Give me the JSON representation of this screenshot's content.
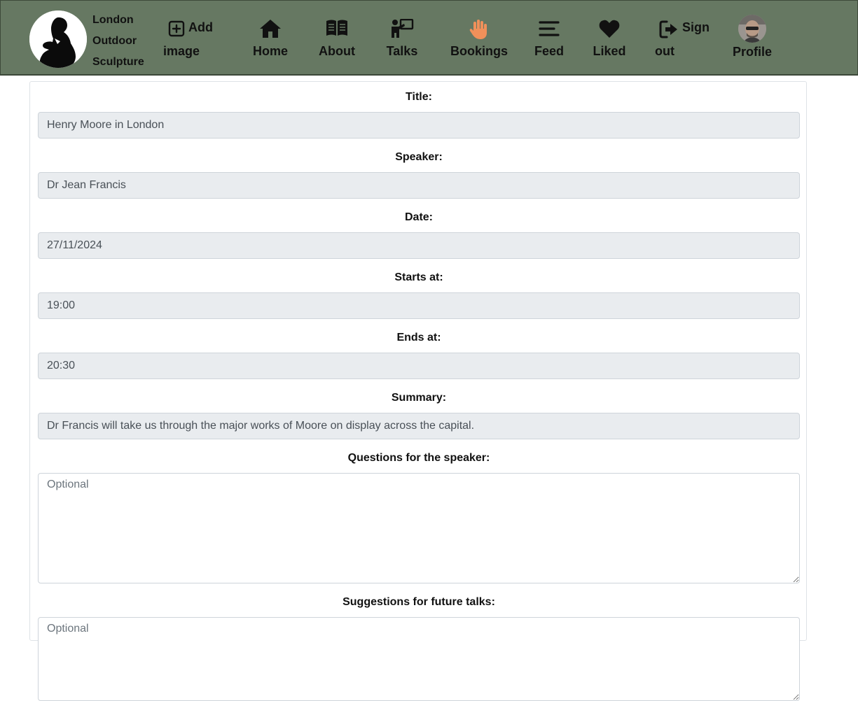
{
  "nav": {
    "brand": {
      "line1": "London",
      "line2": "Outdoor",
      "line3": "Sculpture"
    },
    "add_image": {
      "line1": "Add",
      "line2": "image"
    },
    "home": "Home",
    "about": "About",
    "talks": "Talks",
    "bookings": "Bookings",
    "feed": "Feed",
    "liked": "Liked",
    "sign_out": {
      "line1": "Sign",
      "line2": "out"
    },
    "profile": "Profile",
    "active_item": "Bookings",
    "colors": {
      "bar": "#667862",
      "active_icon": "#f0905a",
      "icon": "#111111"
    }
  },
  "form": {
    "title": {
      "label": "Title:",
      "value": "Henry Moore in London"
    },
    "speaker": {
      "label": "Speaker:",
      "value": "Dr Jean Francis"
    },
    "date": {
      "label": "Date:",
      "value": "27/11/2024"
    },
    "starts_at": {
      "label": "Starts at:",
      "value": "19:00"
    },
    "ends_at": {
      "label": "Ends at:",
      "value": "20:30"
    },
    "summary": {
      "label": "Summary:",
      "value": "Dr Francis will take us through the major works of Moore on display across the capital."
    },
    "questions": {
      "label": "Questions for the speaker:",
      "placeholder": "Optional"
    },
    "suggestions": {
      "label": "Suggestions for future talks:",
      "placeholder": "Optional"
    }
  }
}
